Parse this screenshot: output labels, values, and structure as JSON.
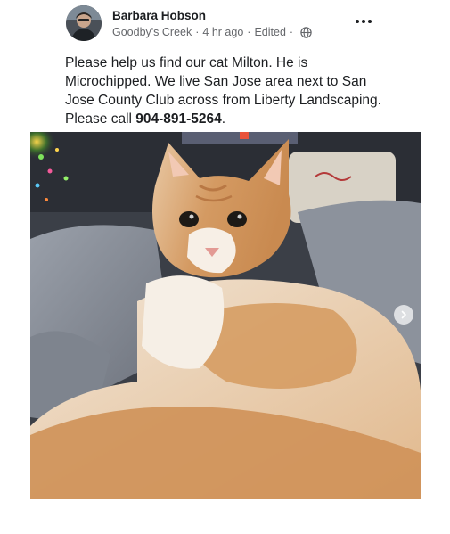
{
  "post": {
    "author": "Barbara Hobson",
    "location": "Goodby's Creek",
    "time": "4 hr ago",
    "edited": "Edited",
    "separator": "·",
    "text_main": "Please help us find our cat Milton. He is Microchipped. We live San Jose area next to San Jose County Club across from Liberty Landscaping. Please call ",
    "phone": "904-891-5264",
    "text_end": "."
  },
  "icons": {
    "audience": "globe-icon",
    "menu": "more-options-icon",
    "next": "chevron-right-icon"
  },
  "colors": {
    "text": "#1c1e21",
    "secondary_text": "#65676b",
    "photo_next_button": "#ebecee"
  }
}
